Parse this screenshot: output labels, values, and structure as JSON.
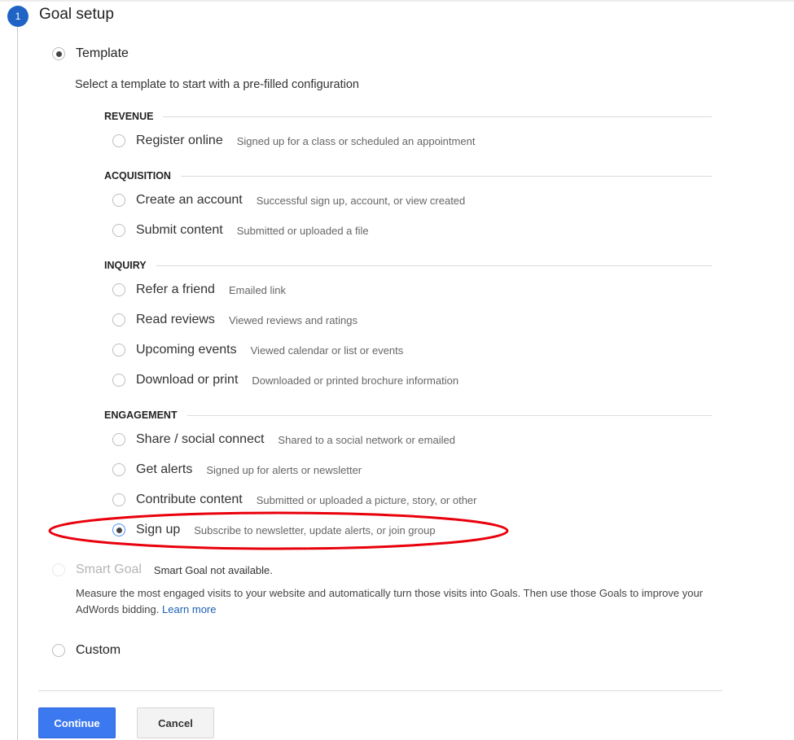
{
  "step": {
    "number": "1",
    "title": "Goal setup"
  },
  "template_option": {
    "label": "Template",
    "selected": true,
    "description": "Select a template to start with a pre-filled configuration"
  },
  "sections": [
    {
      "heading": "REVENUE",
      "items": [
        {
          "name": "Register online",
          "desc": "Signed up for a class or scheduled an appointment",
          "selected": false
        }
      ]
    },
    {
      "heading": "ACQUISITION",
      "items": [
        {
          "name": "Create an account",
          "desc": "Successful sign up, account, or view created",
          "selected": false
        },
        {
          "name": "Submit content",
          "desc": "Submitted or uploaded a file",
          "selected": false
        }
      ]
    },
    {
      "heading": "INQUIRY",
      "items": [
        {
          "name": "Refer a friend",
          "desc": "Emailed link",
          "selected": false
        },
        {
          "name": "Read reviews",
          "desc": "Viewed reviews and ratings",
          "selected": false
        },
        {
          "name": "Upcoming events",
          "desc": "Viewed calendar or list or events",
          "selected": false
        },
        {
          "name": "Download or print",
          "desc": "Downloaded or printed brochure information",
          "selected": false
        }
      ]
    },
    {
      "heading": "ENGAGEMENT",
      "items": [
        {
          "name": "Share / social connect",
          "desc": "Shared to a social network or emailed",
          "selected": false
        },
        {
          "name": "Get alerts",
          "desc": "Signed up for alerts or newsletter",
          "selected": false
        },
        {
          "name": "Contribute content",
          "desc": "Submitted or uploaded a picture, story, or other",
          "selected": false
        },
        {
          "name": "Sign up",
          "desc": "Subscribe to newsletter, update alerts, or join group",
          "selected": true
        }
      ]
    }
  ],
  "smart_goal": {
    "label": "Smart Goal",
    "status": "Smart Goal not available.",
    "description": "Measure the most engaged visits to your website and automatically turn those visits into Goals. Then use those Goals to improve your AdWords bidding.",
    "learn_more": "Learn more",
    "enabled": false
  },
  "custom_option": {
    "label": "Custom",
    "selected": false
  },
  "buttons": {
    "continue": "Continue",
    "cancel": "Cancel"
  },
  "colors": {
    "primary": "#3c78f0",
    "step": "#1f64c4",
    "annotation": "#e8000b",
    "link": "#1a5fb4"
  },
  "annotation": {
    "type": "ellipse",
    "highlights": "Sign up"
  }
}
